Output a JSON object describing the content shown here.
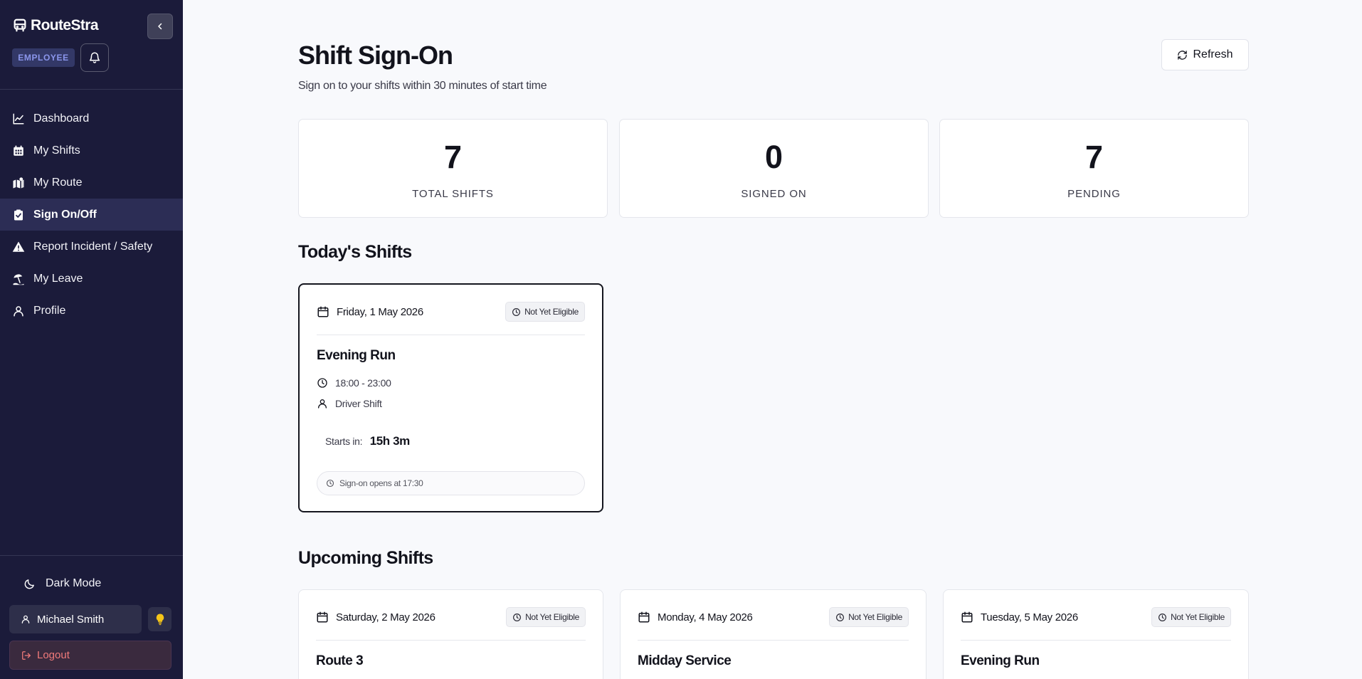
{
  "app": {
    "name": "RouteStra",
    "role_badge": "EMPLOYEE"
  },
  "sidebar": {
    "items": [
      {
        "label": "Dashboard",
        "icon": "chart-line-icon"
      },
      {
        "label": "My Shifts",
        "icon": "calendar-grid-icon"
      },
      {
        "label": "My Route",
        "icon": "map-route-icon"
      },
      {
        "label": "Sign On/Off",
        "icon": "clipboard-check-icon",
        "active": true
      },
      {
        "label": "Report Incident / Safety",
        "icon": "warning-triangle-icon"
      },
      {
        "label": "My Leave",
        "icon": "beach-umbrella-icon"
      },
      {
        "label": "Profile",
        "icon": "user-icon"
      }
    ],
    "dark_mode_label": "Dark Mode",
    "user_name": "Michael Smith",
    "logout_label": "Logout"
  },
  "header": {
    "title": "Shift Sign-On",
    "subtitle": "Sign on to your shifts within 30 minutes of start time",
    "refresh_label": "Refresh"
  },
  "stats": [
    {
      "value": "7",
      "label": "TOTAL SHIFTS"
    },
    {
      "value": "0",
      "label": "SIGNED ON"
    },
    {
      "value": "7",
      "label": "PENDING"
    }
  ],
  "today": {
    "section_title": "Today's Shifts",
    "shift": {
      "date": "Friday, 1 May 2026",
      "status": "Not Yet Eligible",
      "title": "Evening Run",
      "time": "18:00 - 23:00",
      "type": "Driver Shift",
      "starts_in_label": "Starts in:",
      "starts_in_value": "15h 3m",
      "note": "Sign-on opens at 17:30"
    }
  },
  "upcoming": {
    "section_title": "Upcoming Shifts",
    "shifts": [
      {
        "date": "Saturday, 2 May 2026",
        "status": "Not Yet Eligible",
        "title": "Route 3"
      },
      {
        "date": "Monday, 4 May 2026",
        "status": "Not Yet Eligible",
        "title": "Midday Service"
      },
      {
        "date": "Tuesday, 5 May 2026",
        "status": "Not Yet Eligible",
        "title": "Evening Run"
      }
    ]
  },
  "colors": {
    "sidebar_bg": "#1b1b3a",
    "active_nav_bg": "#2c2d55",
    "page_bg": "#f8f9fc",
    "badge_text": "#8b96ec",
    "logout_text": "#f07a7a",
    "tip_icon": "#f5c518"
  }
}
